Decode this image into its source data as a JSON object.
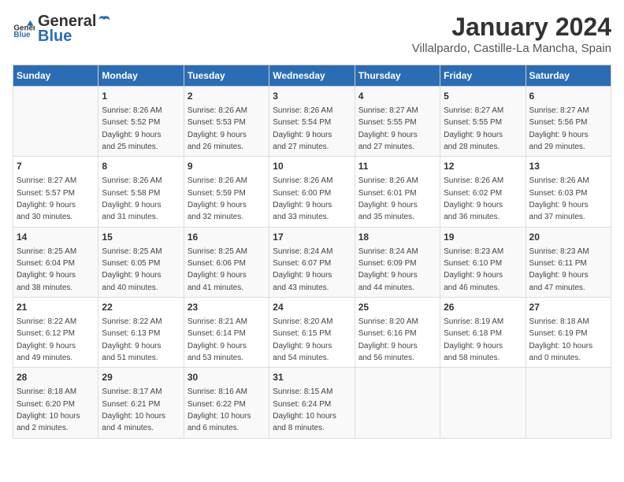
{
  "header": {
    "logo_general": "General",
    "logo_blue": "Blue",
    "title": "January 2024",
    "subtitle": "Villalpardo, Castille-La Mancha, Spain"
  },
  "columns": [
    "Sunday",
    "Monday",
    "Tuesday",
    "Wednesday",
    "Thursday",
    "Friday",
    "Saturday"
  ],
  "weeks": [
    [
      {
        "day": "",
        "info": ""
      },
      {
        "day": "1",
        "info": "Sunrise: 8:26 AM\nSunset: 5:52 PM\nDaylight: 9 hours\nand 25 minutes."
      },
      {
        "day": "2",
        "info": "Sunrise: 8:26 AM\nSunset: 5:53 PM\nDaylight: 9 hours\nand 26 minutes."
      },
      {
        "day": "3",
        "info": "Sunrise: 8:26 AM\nSunset: 5:54 PM\nDaylight: 9 hours\nand 27 minutes."
      },
      {
        "day": "4",
        "info": "Sunrise: 8:27 AM\nSunset: 5:55 PM\nDaylight: 9 hours\nand 27 minutes."
      },
      {
        "day": "5",
        "info": "Sunrise: 8:27 AM\nSunset: 5:55 PM\nDaylight: 9 hours\nand 28 minutes."
      },
      {
        "day": "6",
        "info": "Sunrise: 8:27 AM\nSunset: 5:56 PM\nDaylight: 9 hours\nand 29 minutes."
      }
    ],
    [
      {
        "day": "7",
        "info": "Sunrise: 8:27 AM\nSunset: 5:57 PM\nDaylight: 9 hours\nand 30 minutes."
      },
      {
        "day": "8",
        "info": "Sunrise: 8:26 AM\nSunset: 5:58 PM\nDaylight: 9 hours\nand 31 minutes."
      },
      {
        "day": "9",
        "info": "Sunrise: 8:26 AM\nSunset: 5:59 PM\nDaylight: 9 hours\nand 32 minutes."
      },
      {
        "day": "10",
        "info": "Sunrise: 8:26 AM\nSunset: 6:00 PM\nDaylight: 9 hours\nand 33 minutes."
      },
      {
        "day": "11",
        "info": "Sunrise: 8:26 AM\nSunset: 6:01 PM\nDaylight: 9 hours\nand 35 minutes."
      },
      {
        "day": "12",
        "info": "Sunrise: 8:26 AM\nSunset: 6:02 PM\nDaylight: 9 hours\nand 36 minutes."
      },
      {
        "day": "13",
        "info": "Sunrise: 8:26 AM\nSunset: 6:03 PM\nDaylight: 9 hours\nand 37 minutes."
      }
    ],
    [
      {
        "day": "14",
        "info": "Sunrise: 8:25 AM\nSunset: 6:04 PM\nDaylight: 9 hours\nand 38 minutes."
      },
      {
        "day": "15",
        "info": "Sunrise: 8:25 AM\nSunset: 6:05 PM\nDaylight: 9 hours\nand 40 minutes."
      },
      {
        "day": "16",
        "info": "Sunrise: 8:25 AM\nSunset: 6:06 PM\nDaylight: 9 hours\nand 41 minutes."
      },
      {
        "day": "17",
        "info": "Sunrise: 8:24 AM\nSunset: 6:07 PM\nDaylight: 9 hours\nand 43 minutes."
      },
      {
        "day": "18",
        "info": "Sunrise: 8:24 AM\nSunset: 6:09 PM\nDaylight: 9 hours\nand 44 minutes."
      },
      {
        "day": "19",
        "info": "Sunrise: 8:23 AM\nSunset: 6:10 PM\nDaylight: 9 hours\nand 46 minutes."
      },
      {
        "day": "20",
        "info": "Sunrise: 8:23 AM\nSunset: 6:11 PM\nDaylight: 9 hours\nand 47 minutes."
      }
    ],
    [
      {
        "day": "21",
        "info": "Sunrise: 8:22 AM\nSunset: 6:12 PM\nDaylight: 9 hours\nand 49 minutes."
      },
      {
        "day": "22",
        "info": "Sunrise: 8:22 AM\nSunset: 6:13 PM\nDaylight: 9 hours\nand 51 minutes."
      },
      {
        "day": "23",
        "info": "Sunrise: 8:21 AM\nSunset: 6:14 PM\nDaylight: 9 hours\nand 53 minutes."
      },
      {
        "day": "24",
        "info": "Sunrise: 8:20 AM\nSunset: 6:15 PM\nDaylight: 9 hours\nand 54 minutes."
      },
      {
        "day": "25",
        "info": "Sunrise: 8:20 AM\nSunset: 6:16 PM\nDaylight: 9 hours\nand 56 minutes."
      },
      {
        "day": "26",
        "info": "Sunrise: 8:19 AM\nSunset: 6:18 PM\nDaylight: 9 hours\nand 58 minutes."
      },
      {
        "day": "27",
        "info": "Sunrise: 8:18 AM\nSunset: 6:19 PM\nDaylight: 10 hours\nand 0 minutes."
      }
    ],
    [
      {
        "day": "28",
        "info": "Sunrise: 8:18 AM\nSunset: 6:20 PM\nDaylight: 10 hours\nand 2 minutes."
      },
      {
        "day": "29",
        "info": "Sunrise: 8:17 AM\nSunset: 6:21 PM\nDaylight: 10 hours\nand 4 minutes."
      },
      {
        "day": "30",
        "info": "Sunrise: 8:16 AM\nSunset: 6:22 PM\nDaylight: 10 hours\nand 6 minutes."
      },
      {
        "day": "31",
        "info": "Sunrise: 8:15 AM\nSunset: 6:24 PM\nDaylight: 10 hours\nand 8 minutes."
      },
      {
        "day": "",
        "info": ""
      },
      {
        "day": "",
        "info": ""
      },
      {
        "day": "",
        "info": ""
      }
    ]
  ]
}
